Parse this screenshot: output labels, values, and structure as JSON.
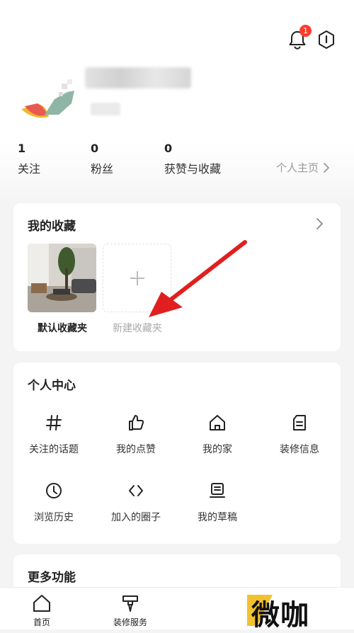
{
  "header": {
    "notification_count": "1"
  },
  "stats": [
    {
      "value": "1",
      "label": "关注"
    },
    {
      "value": "0",
      "label": "粉丝"
    },
    {
      "value": "0",
      "label": "获赞与收藏"
    }
  ],
  "homepage_link": "个人主页",
  "favorites": {
    "title": "我的收藏",
    "default_folder": "默认收藏夹",
    "new_folder": "新建收藏夹"
  },
  "personal_center": {
    "title": "个人中心",
    "items": [
      {
        "label": "关注的话题",
        "icon": "hash-icon"
      },
      {
        "label": "我的点赞",
        "icon": "thumbs-up-icon"
      },
      {
        "label": "我的家",
        "icon": "home-icon"
      },
      {
        "label": "装修信息",
        "icon": "document-icon"
      },
      {
        "label": "浏览历史",
        "icon": "clock-icon"
      },
      {
        "label": "加入的圈子",
        "icon": "code-icon"
      },
      {
        "label": "我的草稿",
        "icon": "draft-icon"
      }
    ]
  },
  "more": {
    "title": "更多功能"
  },
  "bottom_nav": [
    {
      "label": "首页",
      "icon": "home-icon"
    },
    {
      "label": "装修服务",
      "icon": "service-icon"
    }
  ],
  "watermark": "微咖",
  "colors": {
    "badge": "#ff3b30",
    "arrow": "#e02020",
    "page_bg": "#f4f4f5"
  }
}
